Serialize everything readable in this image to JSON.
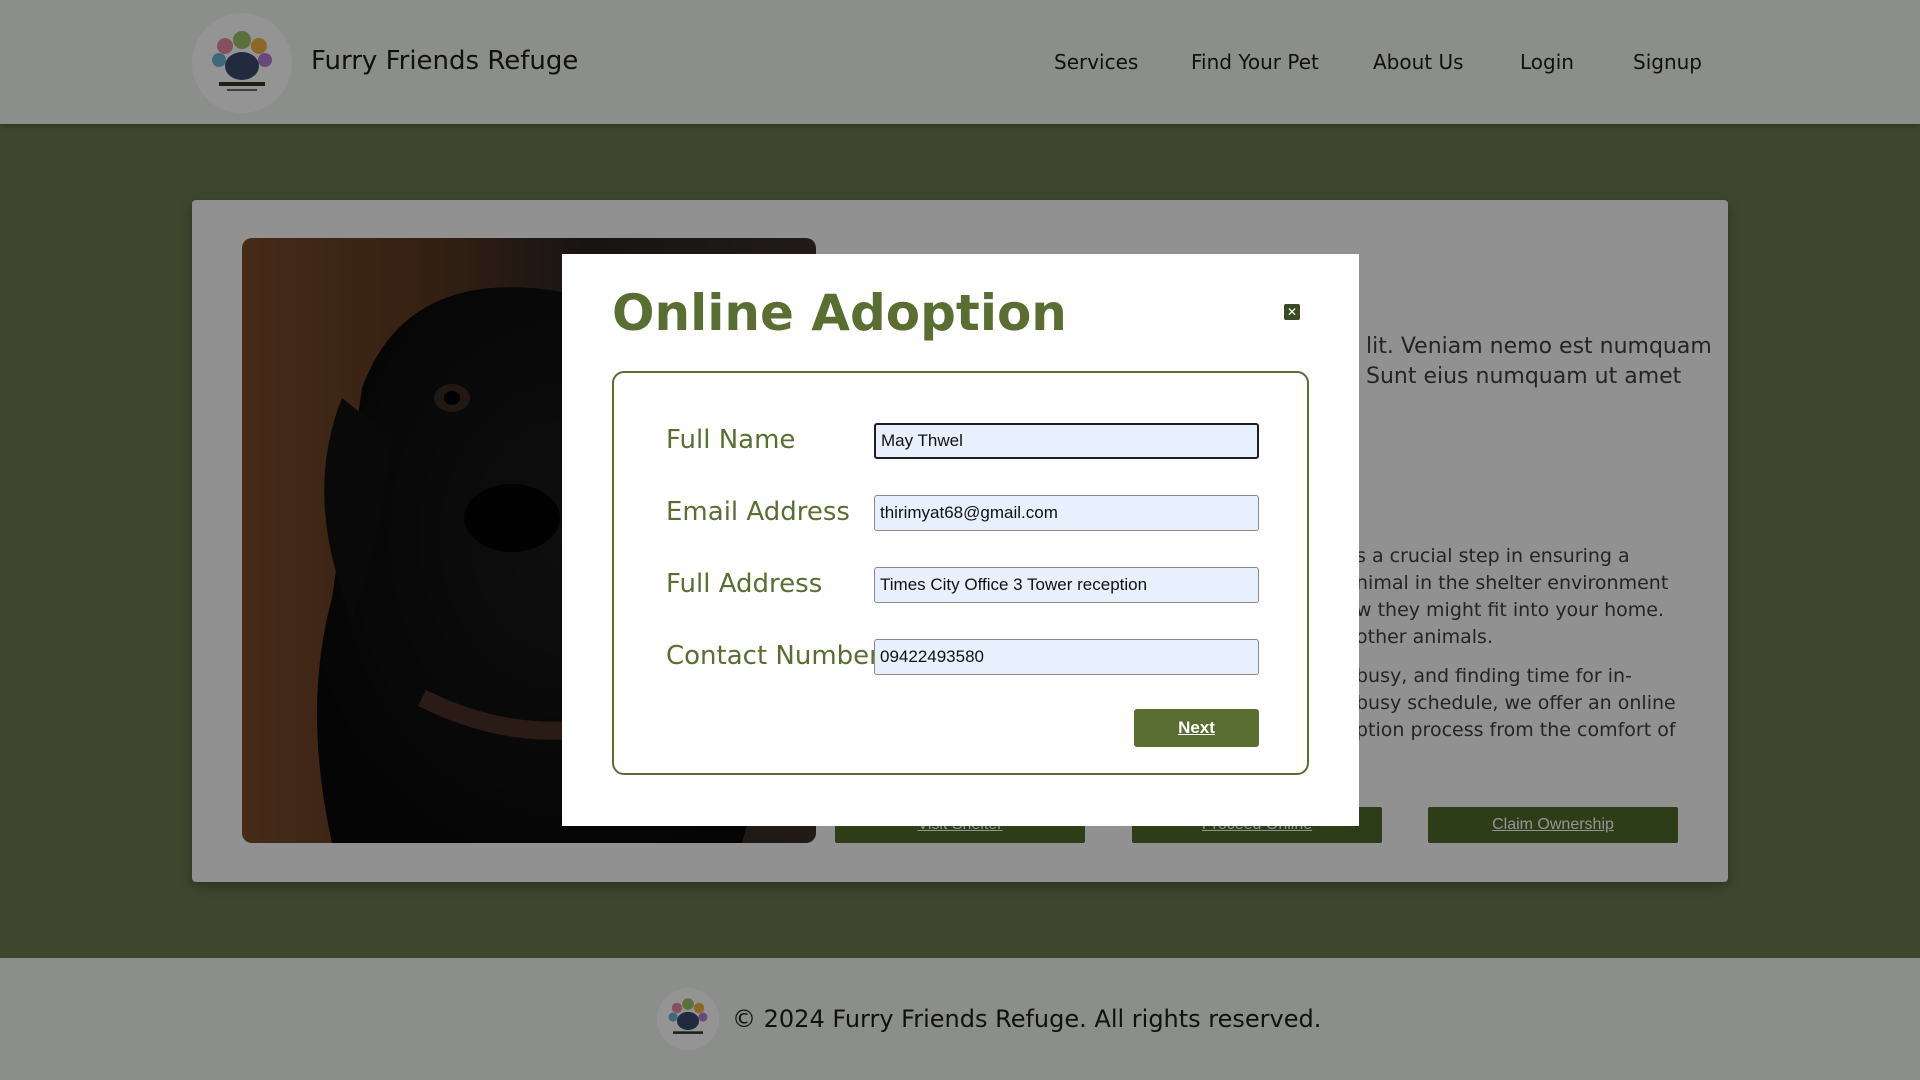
{
  "header": {
    "brand": "Furry Friends Refuge",
    "nav": [
      "Services",
      "Find Your Pet",
      "About Us",
      "Login",
      "Signup"
    ]
  },
  "background": {
    "para1": [
      "lit. Veniam nemo est numquam",
      "Sunt eius numquam ut amet"
    ],
    "para2": [
      "s a crucial step in ensuring a",
      "nimal in the shelter environment",
      "w they might fit into your home.",
      "other animals."
    ],
    "para3": [
      "busy, and finding time for in-",
      "busy schedule, we offer an online",
      "ption process from the comfort of"
    ],
    "buttons": [
      "Visit Shelter",
      "Proceed Online",
      "Claim Ownership"
    ]
  },
  "modal": {
    "title": "Online Adoption",
    "close_icon": "close-icon",
    "fields": [
      {
        "label": "Full Name",
        "value": "May Thwel"
      },
      {
        "label": "Email Address",
        "value": "thirimyat68@gmail.com"
      },
      {
        "label": "Full Address",
        "value": "Times City Office 3 Tower reception"
      },
      {
        "label": "Contact Number",
        "value": "09422493580"
      }
    ],
    "next_label": "Next"
  },
  "footer": {
    "text": "© 2024 Furry Friends Refuge. All rights reserved."
  },
  "colors": {
    "accent": "#5a6e32",
    "header_bg": "#f2f4ef",
    "page_bg": "#6b7a50"
  }
}
